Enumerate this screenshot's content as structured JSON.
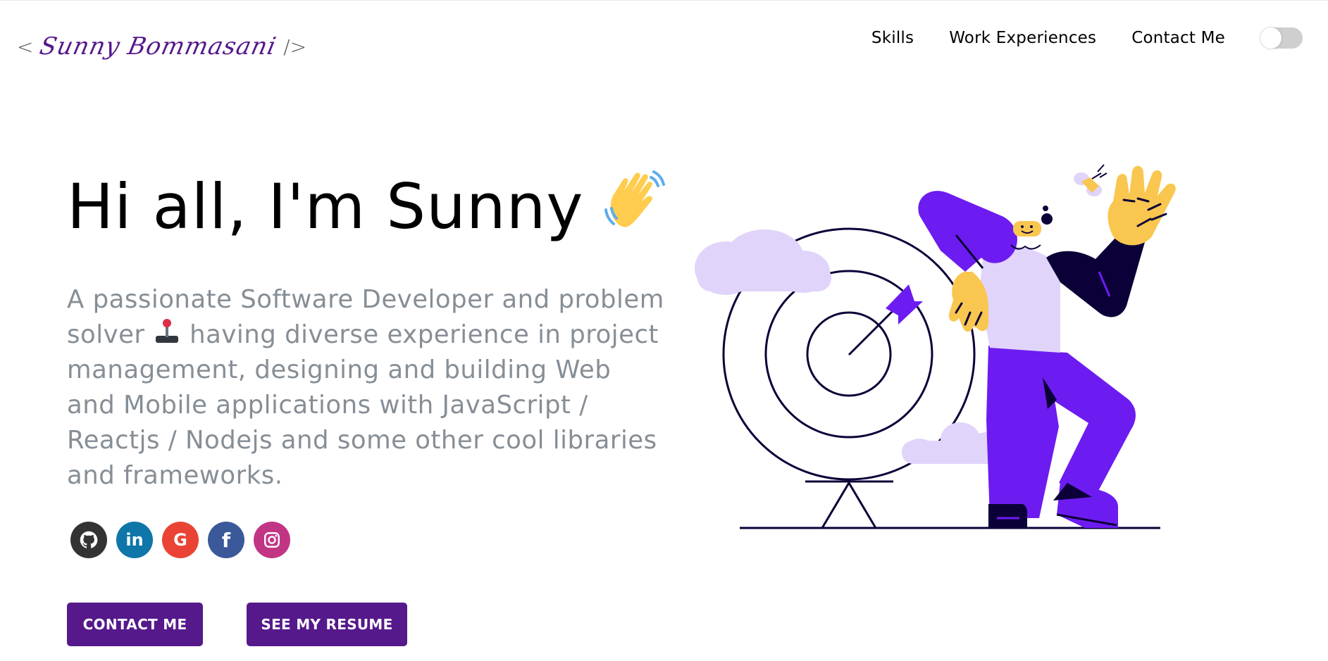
{
  "header": {
    "logo": {
      "open": "<",
      "signature": "Sunny Bommasani",
      "close": "/>"
    },
    "nav": [
      {
        "label": "Skills"
      },
      {
        "label": "Work Experiences"
      },
      {
        "label": "Contact Me"
      }
    ],
    "theme_toggle": {
      "on": false
    }
  },
  "hero": {
    "greeting": "Hi all, I'm Sunny",
    "subtitle_part1": "A passionate Software Developer and problem solver",
    "subtitle_part2": "having diverse experience in project management, designing and building Web and Mobile applications with JavaScript / Reactjs / Nodejs and some other cool libraries and frameworks.",
    "socials": [
      {
        "icon": "github-icon",
        "color": "#333333"
      },
      {
        "icon": "linkedin-icon",
        "color": "#0e76a8",
        "glyph": "in"
      },
      {
        "icon": "google-icon",
        "color": "#ea4335",
        "glyph": "G"
      },
      {
        "icon": "facebook-icon",
        "color": "#3b5998",
        "glyph": "f"
      },
      {
        "icon": "instagram-icon",
        "color": "#c13584"
      }
    ],
    "buttons": {
      "contact": "CONTACT ME",
      "resume": "SEE MY RESUME"
    }
  },
  "colors": {
    "accent": "#55198b",
    "subtitle": "#868e96",
    "illustration_purple": "#6c1cf0",
    "illustration_lavender": "#e0d4fb",
    "illustration_yellow": "#f9c74f",
    "illustration_navy": "#0c0038"
  }
}
